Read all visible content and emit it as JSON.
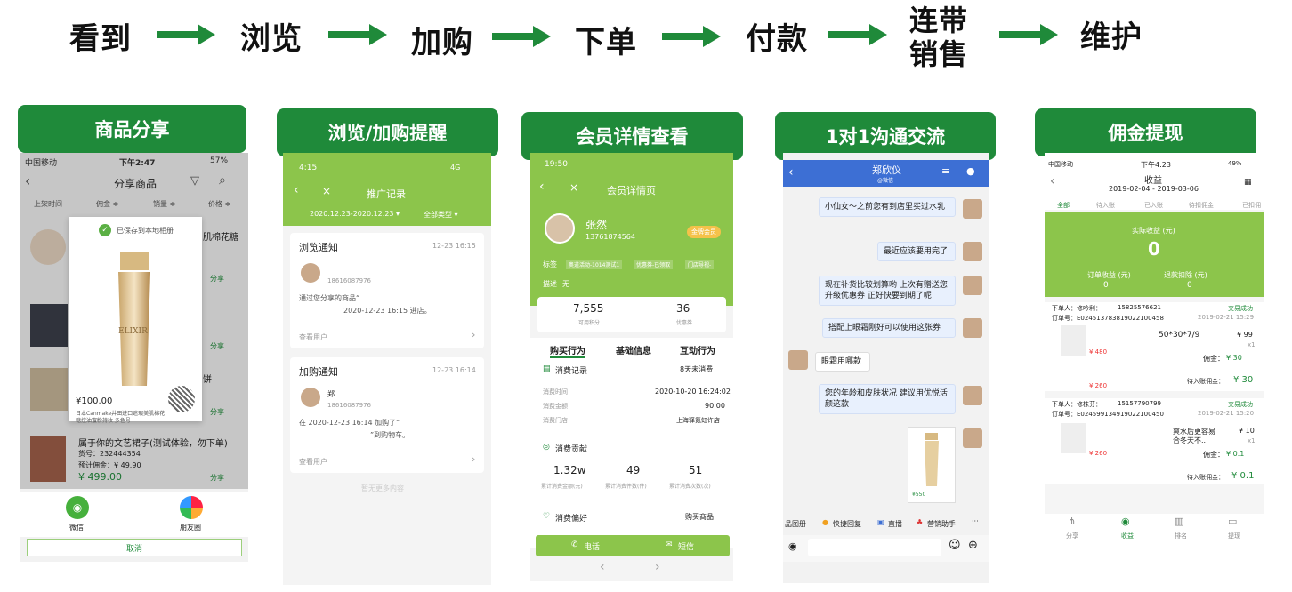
{
  "flow": {
    "steps": [
      "看到",
      "浏览",
      "加购",
      "下单",
      "付款",
      "连带",
      "销售",
      "维护"
    ]
  },
  "sections": {
    "s1": "商品分享",
    "s2": "浏览/加购提醒",
    "s3": "会员详情查看",
    "s4": "1对1沟通交流",
    "s5": "佣金提现"
  },
  "p1": {
    "carrier": "中国移动",
    "time": "下午2:47",
    "battery": "57%",
    "title": "分享商品",
    "filters": [
      "上架时间",
      "佣金 ≑",
      "销量 ≑",
      "价格 ≑"
    ],
    "saved": "已保存到本地相册",
    "brand": "ELIXIR",
    "price": "¥100.00",
    "modal_desc1": "日本Canmake井田进口遮瑕美肌棉花",
    "modal_desc2": "糖控油蜜粉持妆 多色号",
    "item1_title_tail": "肌棉花糖",
    "item3_title_tail": "饼",
    "item4_title": "属于你的文艺裙子(测试体验，勿下单)",
    "item4_no": "货号：232444354",
    "item4_commission": "预计佣金：¥ 49.90",
    "item4_price": "¥ 499.00",
    "share": "分享",
    "wechat": "微信",
    "moments": "朋友圈",
    "cancel": "取消"
  },
  "p2": {
    "time": "4:15",
    "signal": "4G",
    "title": "推广记录",
    "date_range": "2020.12.23-2020.12.23 ▾",
    "type": "全部类型 ▾",
    "card1_title": "浏览通知",
    "card1_time": "12-23 16:15",
    "card1_phone": "18616087976",
    "card1_text1": "通过您分享的商品“",
    "card1_text2": "2020-12-23 16:15 进店。",
    "card1_link": "查看用户",
    "card2_title": "加购通知",
    "card2_time": "12-23 16:14",
    "card2_name": "郑...",
    "card2_phone": "18616087976",
    "card2_text1": "在 2020-12-23 16:14 加购了“",
    "card2_text2": "”到购物车。",
    "card2_link": "查看用户",
    "end": "暂无更多内容"
  },
  "p3": {
    "time": "19:50",
    "title": "会员详情页",
    "name": "张然",
    "phone": "13761874564",
    "badge": "金牌会员",
    "tags_label": "标签",
    "tags": [
      "奥道活动-1014测试1",
      "优惠券-已领取",
      "门店导视-"
    ],
    "desc_label": "描述",
    "desc_val": "无",
    "points": "7,555",
    "points_label": "可用积分",
    "coupons": "36",
    "coupons_label": "优惠券",
    "tabs": [
      "购买行为",
      "基础信息",
      "互动行为"
    ],
    "record_label": "消费记录",
    "record_days": "8天未消费",
    "row_labels": [
      "消费时间",
      "消费金额",
      "消费门店"
    ],
    "row_values": [
      "2020-10-20 16:24:02",
      "90.00",
      "上海驿氪虹许店"
    ],
    "contrib_label": "消费贡献",
    "stats": [
      "1.32w",
      "49",
      "51"
    ],
    "stat_labels": [
      "累计消费金额(元)",
      "累计消费件数(件)",
      "累计消费次数(次)"
    ],
    "pref_label": "消费偏好",
    "pref_value": "购买商品",
    "call": "电话",
    "sms": "短信"
  },
  "p4": {
    "name": "郑欣仪",
    "sub": "@微信",
    "msgs": [
      "小仙女～之前您有到店里买过水乳",
      "最近应该要用完了",
      "现在补货比较划算哟 上次有赠送您升级优惠券 正好快要到期了呢",
      "搭配上眼霜刚好可以使用这张券",
      "眼霜用哪款",
      "您的年龄和皮肤状况 建议用优悦活颜这款"
    ],
    "product_price": "¥550",
    "toolbar": [
      "品图册",
      "快捷回复",
      "直播",
      "营销助手"
    ]
  },
  "p5": {
    "carrier": "中国移动",
    "time": "下午4:23",
    "battery": "49%",
    "title": "收益",
    "range": "2019-02-04 - 2019-03-06",
    "tabs": [
      "全部",
      "待入账",
      "已入账",
      "待扣佣金",
      "已扣佣"
    ],
    "actual_label": "实际收益 (元)",
    "actual": "0",
    "order_label": "订单收益 (元)",
    "order_val": "0",
    "refund_label": "退款扣除 (元)",
    "refund_val": "0",
    "o1_buyer": "下单人：修吟利：",
    "o1_phone": "15825576621",
    "o1_status": "交易成功",
    "o1_no": "订单号：E024513783819022100458",
    "o1_date": "2019-02-21 15:29",
    "o1_item": "50*30*7/9",
    "o1_price": "¥ 99",
    "o1_qty": "x1",
    "o1_p1": "¥ 480",
    "o1_p2": "¥ 260",
    "o1_comm_label": "佣金：",
    "o1_comm": "¥ 30",
    "o1_pending_label": "待入账佣金：",
    "o1_pending": "¥ 30",
    "o2_buyer": "下单人：修株芬：",
    "o2_phone": "15157790799",
    "o2_status": "交易成功",
    "o2_no": "订单号：E024599134919022100450",
    "o2_date": "2019-02-21 15:20",
    "o2_item1": "爽水后更容易",
    "o2_item2": "合冬天不...",
    "o2_price": "¥ 10",
    "o2_qty": "x1",
    "o2_p1": "¥ 260",
    "o2_comm_label": "佣金：",
    "o2_comm": "¥ 0.1",
    "o2_pending_label": "待入账佣金：",
    "o2_pending": "¥ 0.1",
    "nav": [
      "分享",
      "收益",
      "排名",
      "提现"
    ]
  }
}
